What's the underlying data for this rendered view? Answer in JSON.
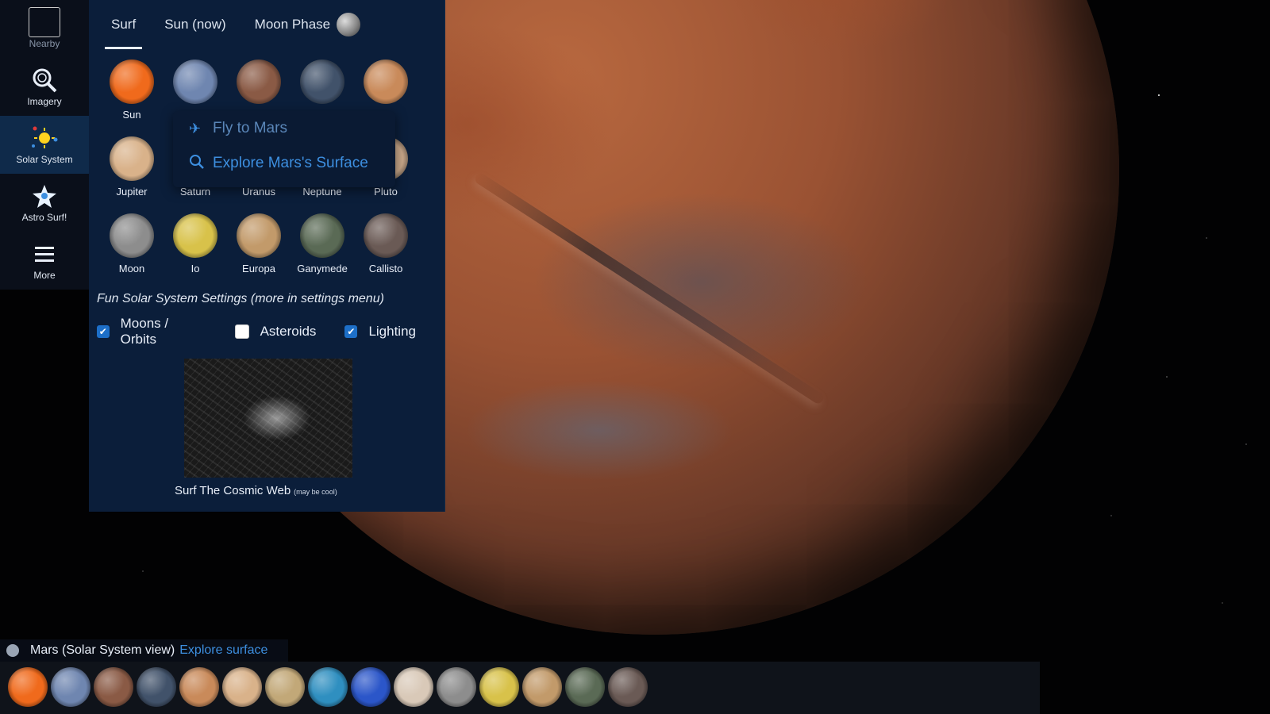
{
  "sidenav": {
    "items": [
      {
        "label": "Nearby",
        "icon": "nearby-icon"
      },
      {
        "label": "Imagery",
        "icon": "imagery-icon"
      },
      {
        "label": "Solar System",
        "icon": "solar-system-icon"
      },
      {
        "label": "Astro Surf!",
        "icon": "astro-surf-icon"
      },
      {
        "label": "More",
        "icon": "menu-icon"
      }
    ],
    "active": "Solar System"
  },
  "tabs": [
    {
      "label": "Surf",
      "active": true
    },
    {
      "label": "Sun (now)",
      "active": false
    },
    {
      "label": "Moon Phase",
      "active": false
    }
  ],
  "bodies": [
    {
      "label": "Sun",
      "color": "#f06a1c"
    },
    {
      "label": "",
      "color": "#6f86b0"
    },
    {
      "label": "",
      "color": "#8a5a45"
    },
    {
      "label": "",
      "color": "#41526a"
    },
    {
      "label": "",
      "color": "#c98a5a"
    },
    {
      "label": "Jupiter",
      "color": "#d9b28a"
    },
    {
      "label": "Saturn",
      "color": "#c2a878"
    },
    {
      "label": "Uranus",
      "color": "#5fa3c7"
    },
    {
      "label": "Neptune",
      "color": "#3d63c9"
    },
    {
      "label": "Pluto",
      "color": "#c9a88a"
    },
    {
      "label": "Moon",
      "color": "#8d8d8d"
    },
    {
      "label": "Io",
      "color": "#d8c24a"
    },
    {
      "label": "Europa",
      "color": "#c29a6a"
    },
    {
      "label": "Ganymede",
      "color": "#5a6a55"
    },
    {
      "label": "Callisto",
      "color": "#6a5a55"
    }
  ],
  "popup": {
    "fly_label": "Fly to Mars",
    "explore_label": "Explore Mars's Surface"
  },
  "settings": {
    "title": "Fun Solar System Settings (more in settings menu)",
    "checks": [
      {
        "label": "Moons / Orbits",
        "checked": true
      },
      {
        "label": "Asteroids",
        "checked": false
      },
      {
        "label": "Lighting",
        "checked": true
      }
    ]
  },
  "cosmic": {
    "label": "Surf The Cosmic Web",
    "note": "(may be cool)"
  },
  "info": {
    "text": "Mars  (Solar System view)",
    "link": "Explore surface"
  },
  "strip": [
    "#f06a1c",
    "#6f86b0",
    "#8a5a45",
    "#41526a",
    "#c98a5a",
    "#d9b28a",
    "#c2a878",
    "#2f8fc0",
    "#2b56c9",
    "#d9c9b8",
    "#8d8d8d",
    "#d8c24a",
    "#c29a6a",
    "#5a6a55",
    "#6a5a55"
  ]
}
